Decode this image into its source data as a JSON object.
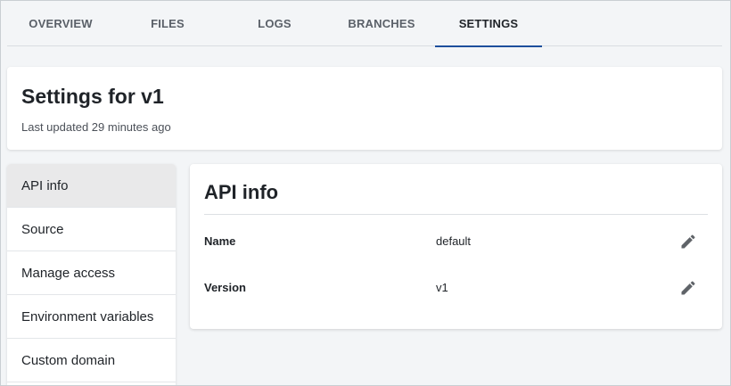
{
  "tabs": [
    {
      "label": "OVERVIEW"
    },
    {
      "label": "FILES"
    },
    {
      "label": "LOGS"
    },
    {
      "label": "BRANCHES"
    },
    {
      "label": "SETTINGS",
      "active": true
    }
  ],
  "header": {
    "title": "Settings for v1",
    "subtitle": "Last updated 29 minutes ago"
  },
  "sidebar": {
    "items": [
      {
        "label": "API info",
        "active": true
      },
      {
        "label": "Source"
      },
      {
        "label": "Manage access"
      },
      {
        "label": "Environment variables"
      },
      {
        "label": "Custom domain"
      }
    ]
  },
  "api_info": {
    "title": "API info",
    "rows": [
      {
        "label": "Name",
        "value": "default",
        "icon": "pencil-icon"
      },
      {
        "label": "Version",
        "value": "v1",
        "icon": "pencil-icon"
      }
    ]
  },
  "colors": {
    "accent": "#1d4f9c",
    "background": "#f3f5f7",
    "active_nav": "#e9e9ea"
  }
}
